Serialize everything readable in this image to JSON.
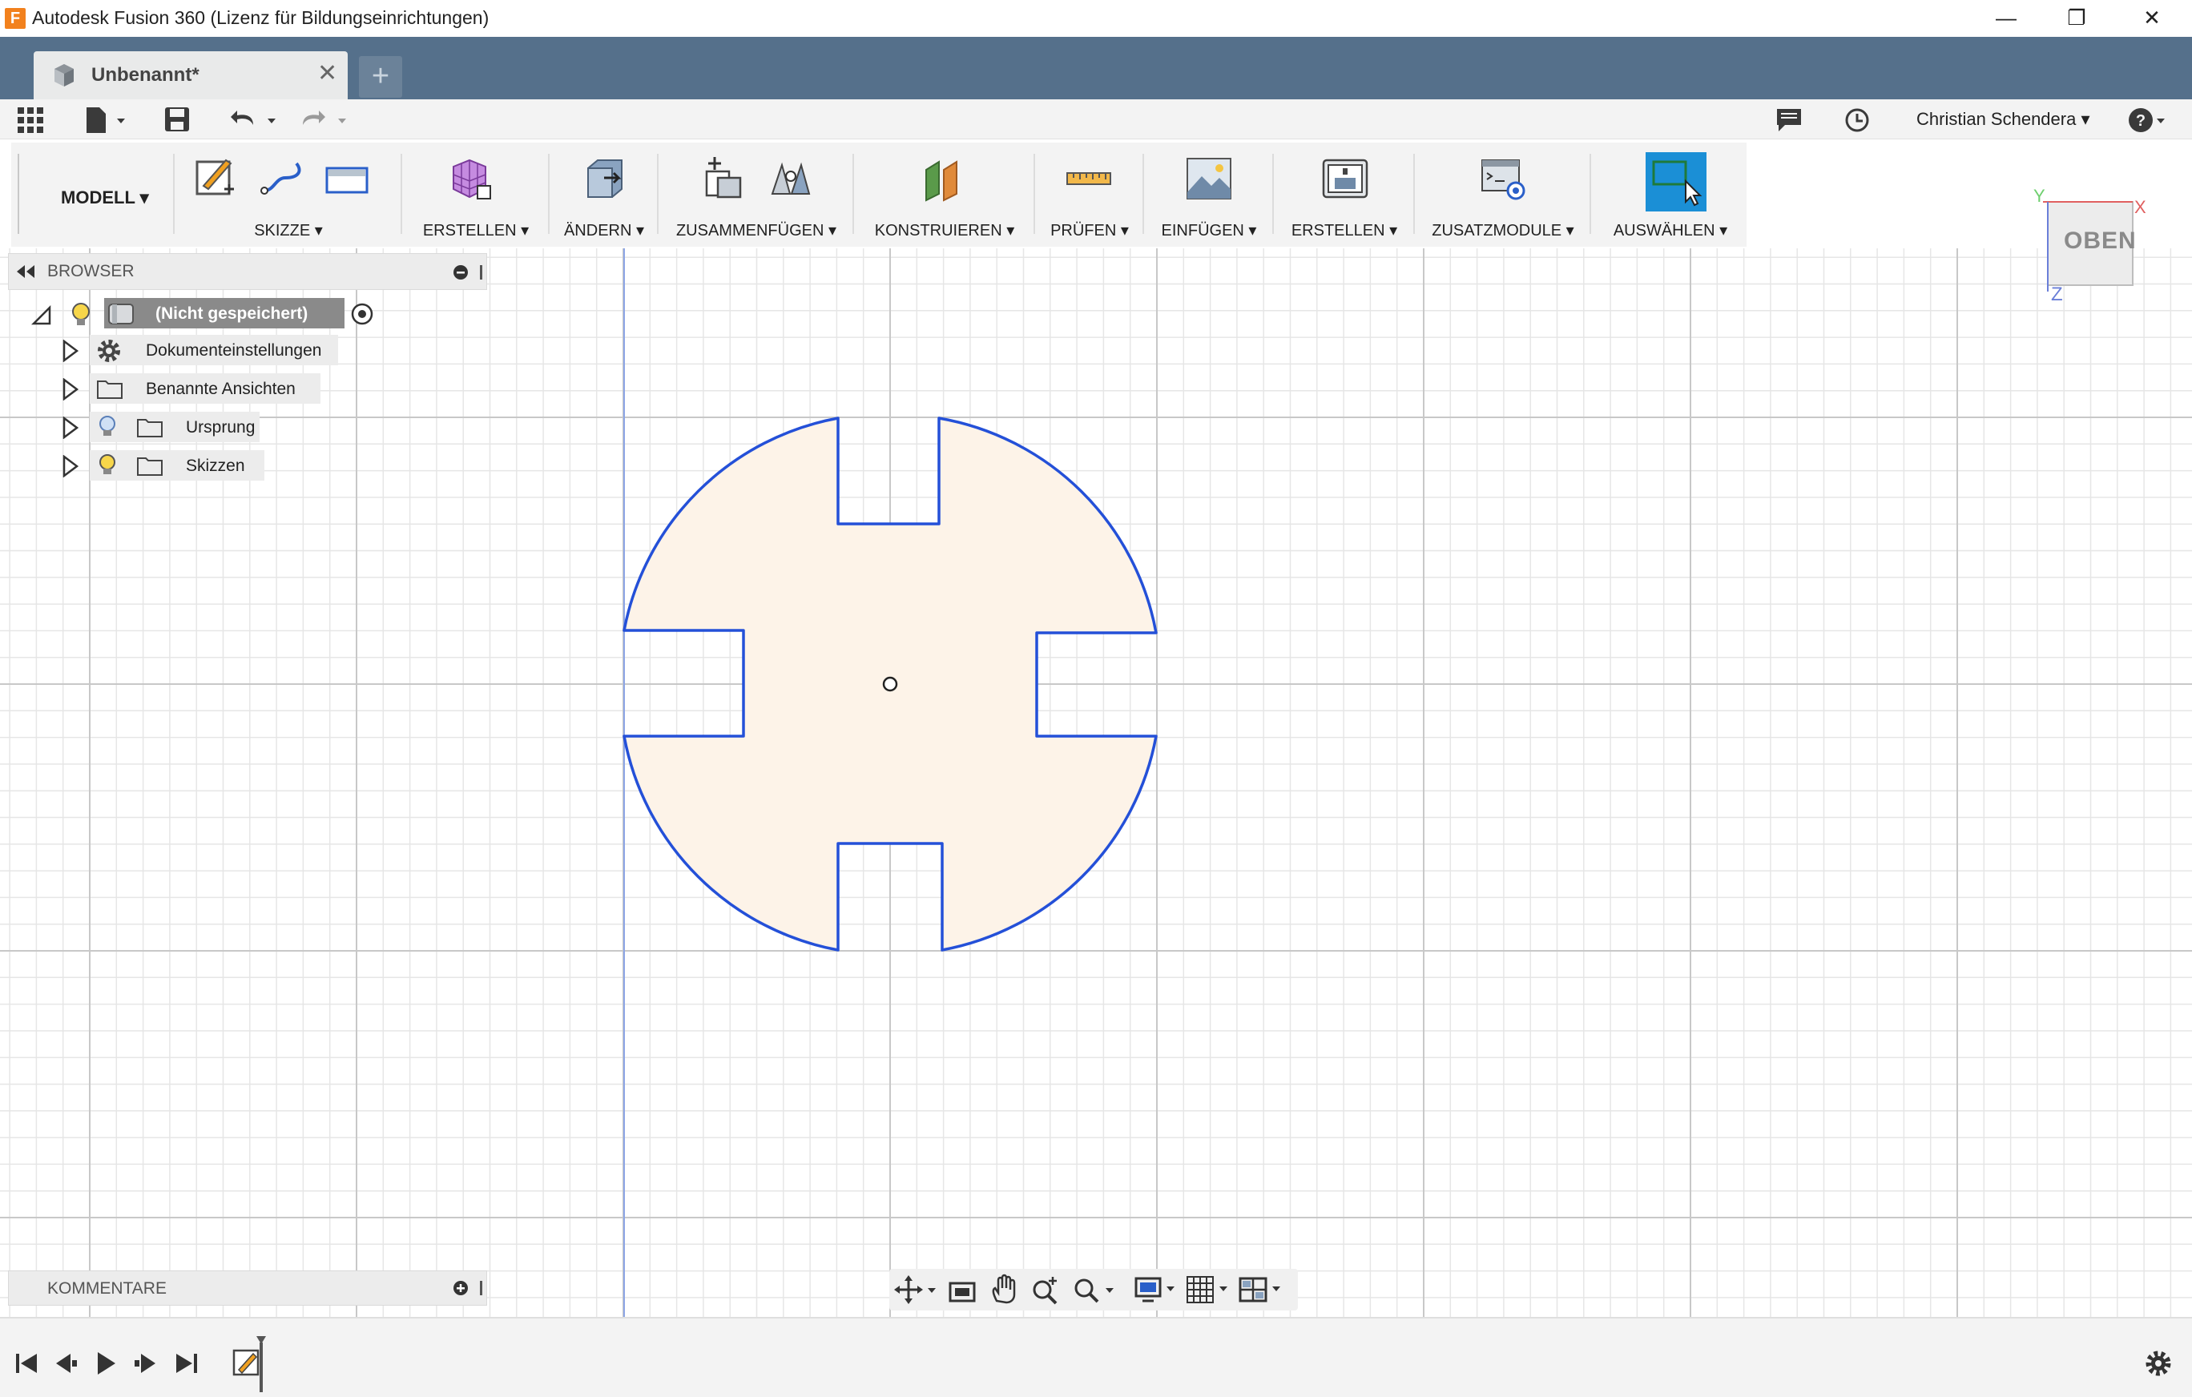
{
  "window": {
    "title": "Autodesk Fusion 360 (Lizenz für Bildungseinrichtungen)",
    "logo_letter": "F",
    "minimize": "—",
    "maximize": "❐",
    "close": "✕"
  },
  "tab": {
    "title": "Unbenannt*",
    "close": "✕",
    "new_tab": "+"
  },
  "quickbar": {
    "user": "Christian Schendera ▾",
    "help": "?"
  },
  "toolbar": {
    "workspace": "MODELL ▾",
    "groups": [
      {
        "label": "SKIZZE ▾"
      },
      {
        "label": "ERSTELLEN ▾"
      },
      {
        "label": "ÄNDERN ▾"
      },
      {
        "label": "ZUSAMMENFÜGEN ▾"
      },
      {
        "label": "KONSTRUIEREN ▾"
      },
      {
        "label": "PRÜFEN ▾"
      },
      {
        "label": "EINFÜGEN ▾"
      },
      {
        "label": "ERSTELLEN ▾"
      },
      {
        "label": "ZUSATZMODULE ▾"
      },
      {
        "label": "AUSWÄHLEN ▾"
      }
    ]
  },
  "browser": {
    "title": "BROWSER",
    "root": "(Nicht gespeichert)",
    "items": [
      {
        "label": "Dokumenteinstellungen",
        "icon": "gear-icon"
      },
      {
        "label": "Benannte Ansichten",
        "icon": "folder-icon"
      },
      {
        "label": "Ursprung",
        "icon": "folder-icon"
      },
      {
        "label": "Skizzen",
        "icon": "folder-icon"
      }
    ]
  },
  "comments": {
    "title": "KOMMENTARE"
  },
  "viewcube": {
    "face": "OBEN",
    "x_axis": "X",
    "y_axis": "Y",
    "z_axis": "Z"
  },
  "colors": {
    "titlebar_tab_strip": "#55708b",
    "sketch_line": "#2450d8",
    "profile_fill": "#fdf3e8",
    "select_active": "#1b8fd6"
  }
}
